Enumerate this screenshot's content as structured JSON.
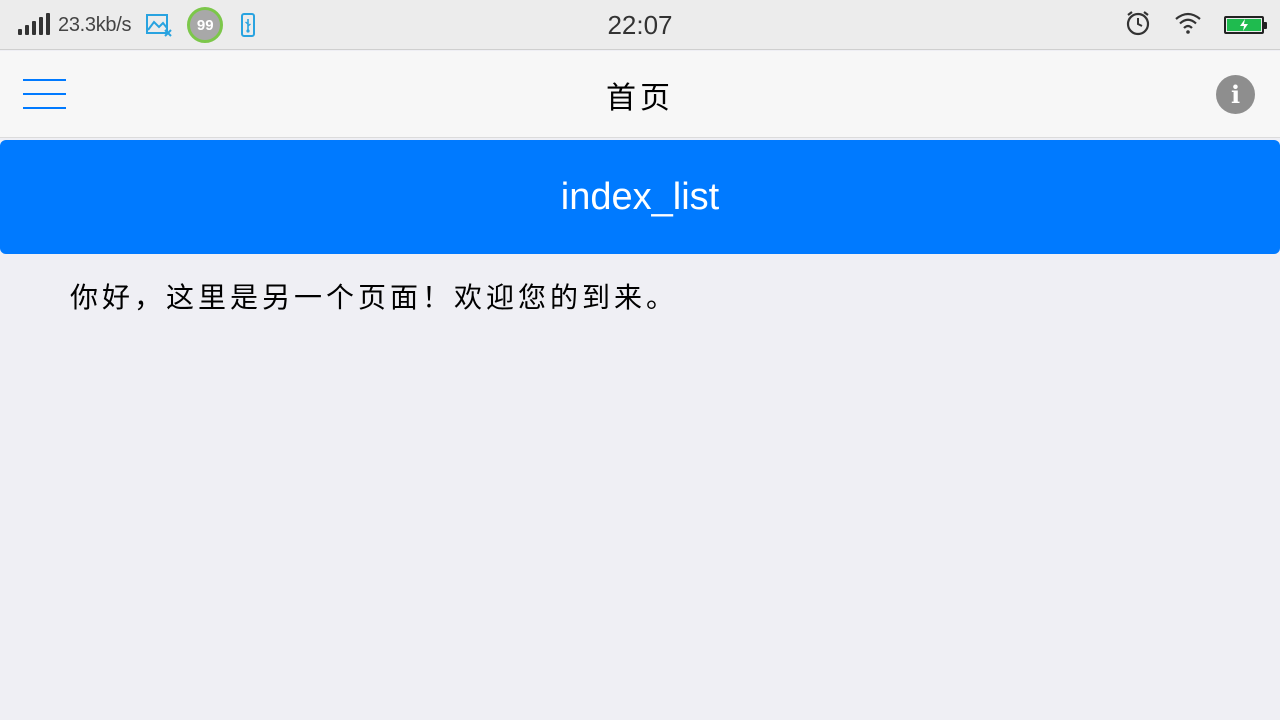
{
  "status_bar": {
    "net_speed": "23.3kb/s",
    "badge_count": "99",
    "time": "22:07",
    "icons": [
      "signal-icon",
      "gallery-icon",
      "usb-icon",
      "alarm-icon",
      "wifi-icon",
      "battery-icon"
    ],
    "battery_color": "#1fbb4f",
    "battery_level": 1.0
  },
  "navbar": {
    "title": "首页",
    "menu_icon": "hamburger-menu-icon",
    "info_icon": "info-icon",
    "info_glyph": "i",
    "accent_color": "#007aff"
  },
  "main": {
    "button_label": "index_list",
    "button_color": "#007aff",
    "message": "你好，这里是另一个页面！欢迎您的到来。"
  }
}
